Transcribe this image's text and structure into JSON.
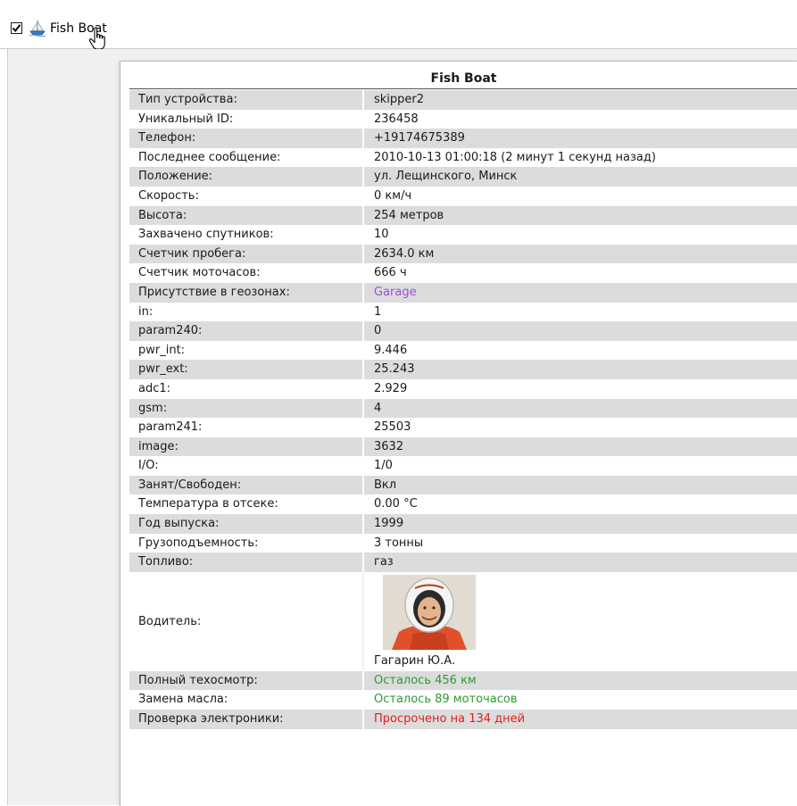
{
  "unit": {
    "name": "Fish Boat",
    "checked": true,
    "icon": "ship-icon"
  },
  "tooltip": {
    "title": "Fish Boat",
    "rows": [
      {
        "label": "Тип устройства:",
        "value": "skipper2"
      },
      {
        "label": "Уникальный ID:",
        "value": "236458"
      },
      {
        "label": "Телефон:",
        "value": "+19174675389"
      },
      {
        "label": "Последнее сообщение:",
        "value": "2010-10-13 01:00:18 (2 минут 1 секунд назад)"
      },
      {
        "label": "Положение:",
        "value": "ул. Лещинского, Минск"
      },
      {
        "label": "Скорость:",
        "value": "0 км/ч"
      },
      {
        "label": "Высота:",
        "value": "254 метров"
      },
      {
        "label": "Захвачено спутников:",
        "value": "10"
      },
      {
        "label": "Счетчик пробега:",
        "value": "2634.0 км"
      },
      {
        "label": "Счетчик моточасов:",
        "value": "666 ч"
      },
      {
        "label": "Присутствие в геозонах:",
        "value": "Garage",
        "color": "#9b4fd9"
      },
      {
        "label": "in:",
        "value": "1"
      },
      {
        "label": "param240:",
        "value": "0"
      },
      {
        "label": "pwr_int:",
        "value": "9.446"
      },
      {
        "label": "pwr_ext:",
        "value": "25.243"
      },
      {
        "label": "adc1:",
        "value": "2.929"
      },
      {
        "label": "gsm:",
        "value": "4"
      },
      {
        "label": "param241:",
        "value": "25503"
      },
      {
        "label": "image:",
        "value": "3632"
      },
      {
        "label": "I/O:",
        "value": "1/0"
      },
      {
        "label": "Занят/Свободен:",
        "value": "Вкл"
      },
      {
        "label": "Температура в отсеке:",
        "value": "0.00 °C"
      },
      {
        "label": "Год выпуска:",
        "value": "1999"
      },
      {
        "label": "Грузоподъемность:",
        "value": "3 тонны"
      },
      {
        "label": "Топливо:",
        "value": "газ"
      }
    ],
    "driver": {
      "label": "Водитель:",
      "name": "Гагарин Ю.А."
    },
    "service_rows": [
      {
        "label": "Полный техосмотр:",
        "value": "Осталось 456 км",
        "color": "#2e9b2e"
      },
      {
        "label": "Замена масла:",
        "value": "Осталось 89 моточасов",
        "color": "#2e9b2e"
      },
      {
        "label": "Проверка электроники:",
        "value": "Просрочено на 134 дней",
        "color": "#e02020"
      }
    ]
  }
}
